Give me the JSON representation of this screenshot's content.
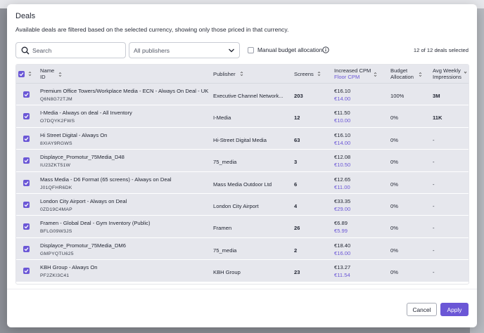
{
  "modal": {
    "title": "Deals",
    "subtitle": "Available deals are filtered based on the selected currency, showing only those priced in that currency."
  },
  "filters": {
    "search_placeholder": "Search",
    "publisher_select": "All publishers",
    "manual_label": "Manual budget allocation",
    "selected_count": "12 of 12 deals selected"
  },
  "columns": {
    "name": "Name",
    "id": "ID",
    "publisher": "Publisher",
    "screens": "Screens",
    "cpm": "Increased CPM",
    "floor": "Floor CPM",
    "budget_1": "Budget",
    "budget_2": "Allocation",
    "imp_1": "Avg Weekly",
    "imp_2": "Impressions"
  },
  "rows": [
    {
      "name": "Premium Office Towers/Workplace Media - ECN - Always On Deal - UK",
      "id": "Q6N8G72TJM",
      "publisher": "Executive Channel Network...",
      "screens": "203",
      "cpm": "€16.10",
      "floor": "€14.00",
      "alloc": "100%",
      "imp": "3M"
    },
    {
      "name": "I-Media - Always on deal - All Inventory",
      "id": "O7DQYK2FWS",
      "publisher": "I-Media",
      "screens": "12",
      "cpm": "€11.50",
      "floor": "€10.00",
      "alloc": "0%",
      "imp": "11K"
    },
    {
      "name": "Hi Street Digital - Always On",
      "id": "8XIAY9RGWS",
      "publisher": "Hi-Street Digital Media",
      "screens": "63",
      "cpm": "€16.10",
      "floor": "€14.00",
      "alloc": "0%",
      "imp": "-"
    },
    {
      "name": "Displayce_Promotur_75Media_D48",
      "id": "IU23ZKT51W",
      "publisher": "75_media",
      "screens": "3",
      "cpm": "€12.08",
      "floor": "€10.50",
      "alloc": "0%",
      "imp": "-"
    },
    {
      "name": "Mass Media - D6 Format (65 screens) - Always on Deal",
      "id": "J01QFHR6DK",
      "publisher": "Mass Media Outdoor Ltd",
      "screens": "6",
      "cpm": "€12.65",
      "floor": "€11.00",
      "alloc": "0%",
      "imp": "-"
    },
    {
      "name": "London City Airport - Always on Deal",
      "id": "0ZD19C4MAP",
      "publisher": "London City Airport",
      "screens": "4",
      "cpm": "€33.35",
      "floor": "€29.00",
      "alloc": "0%",
      "imp": "-"
    },
    {
      "name": "Framen - Global Deal - Gym Inventory (Public)",
      "id": "BFLG09W3JS",
      "publisher": "Framen",
      "screens": "26",
      "cpm": "€6.89",
      "floor": "€5.99",
      "alloc": "0%",
      "imp": "-"
    },
    {
      "name": "Displayce_Promotur_75Media_DM6",
      "id": "GMPYQTU625",
      "publisher": "75_media",
      "screens": "2",
      "cpm": "€18.40",
      "floor": "€16.00",
      "alloc": "0%",
      "imp": "-"
    },
    {
      "name": "KBH Group - Always On",
      "id": "PF2ZKI3C41",
      "publisher": "KBH Group",
      "screens": "23",
      "cpm": "€13.27",
      "floor": "€11.54",
      "alloc": "0%",
      "imp": "-"
    }
  ],
  "footer": {
    "cancel": "Cancel",
    "apply": "Apply"
  },
  "colors": {
    "accent": "#6b57d6",
    "row_bg": "#e6e7ed"
  }
}
